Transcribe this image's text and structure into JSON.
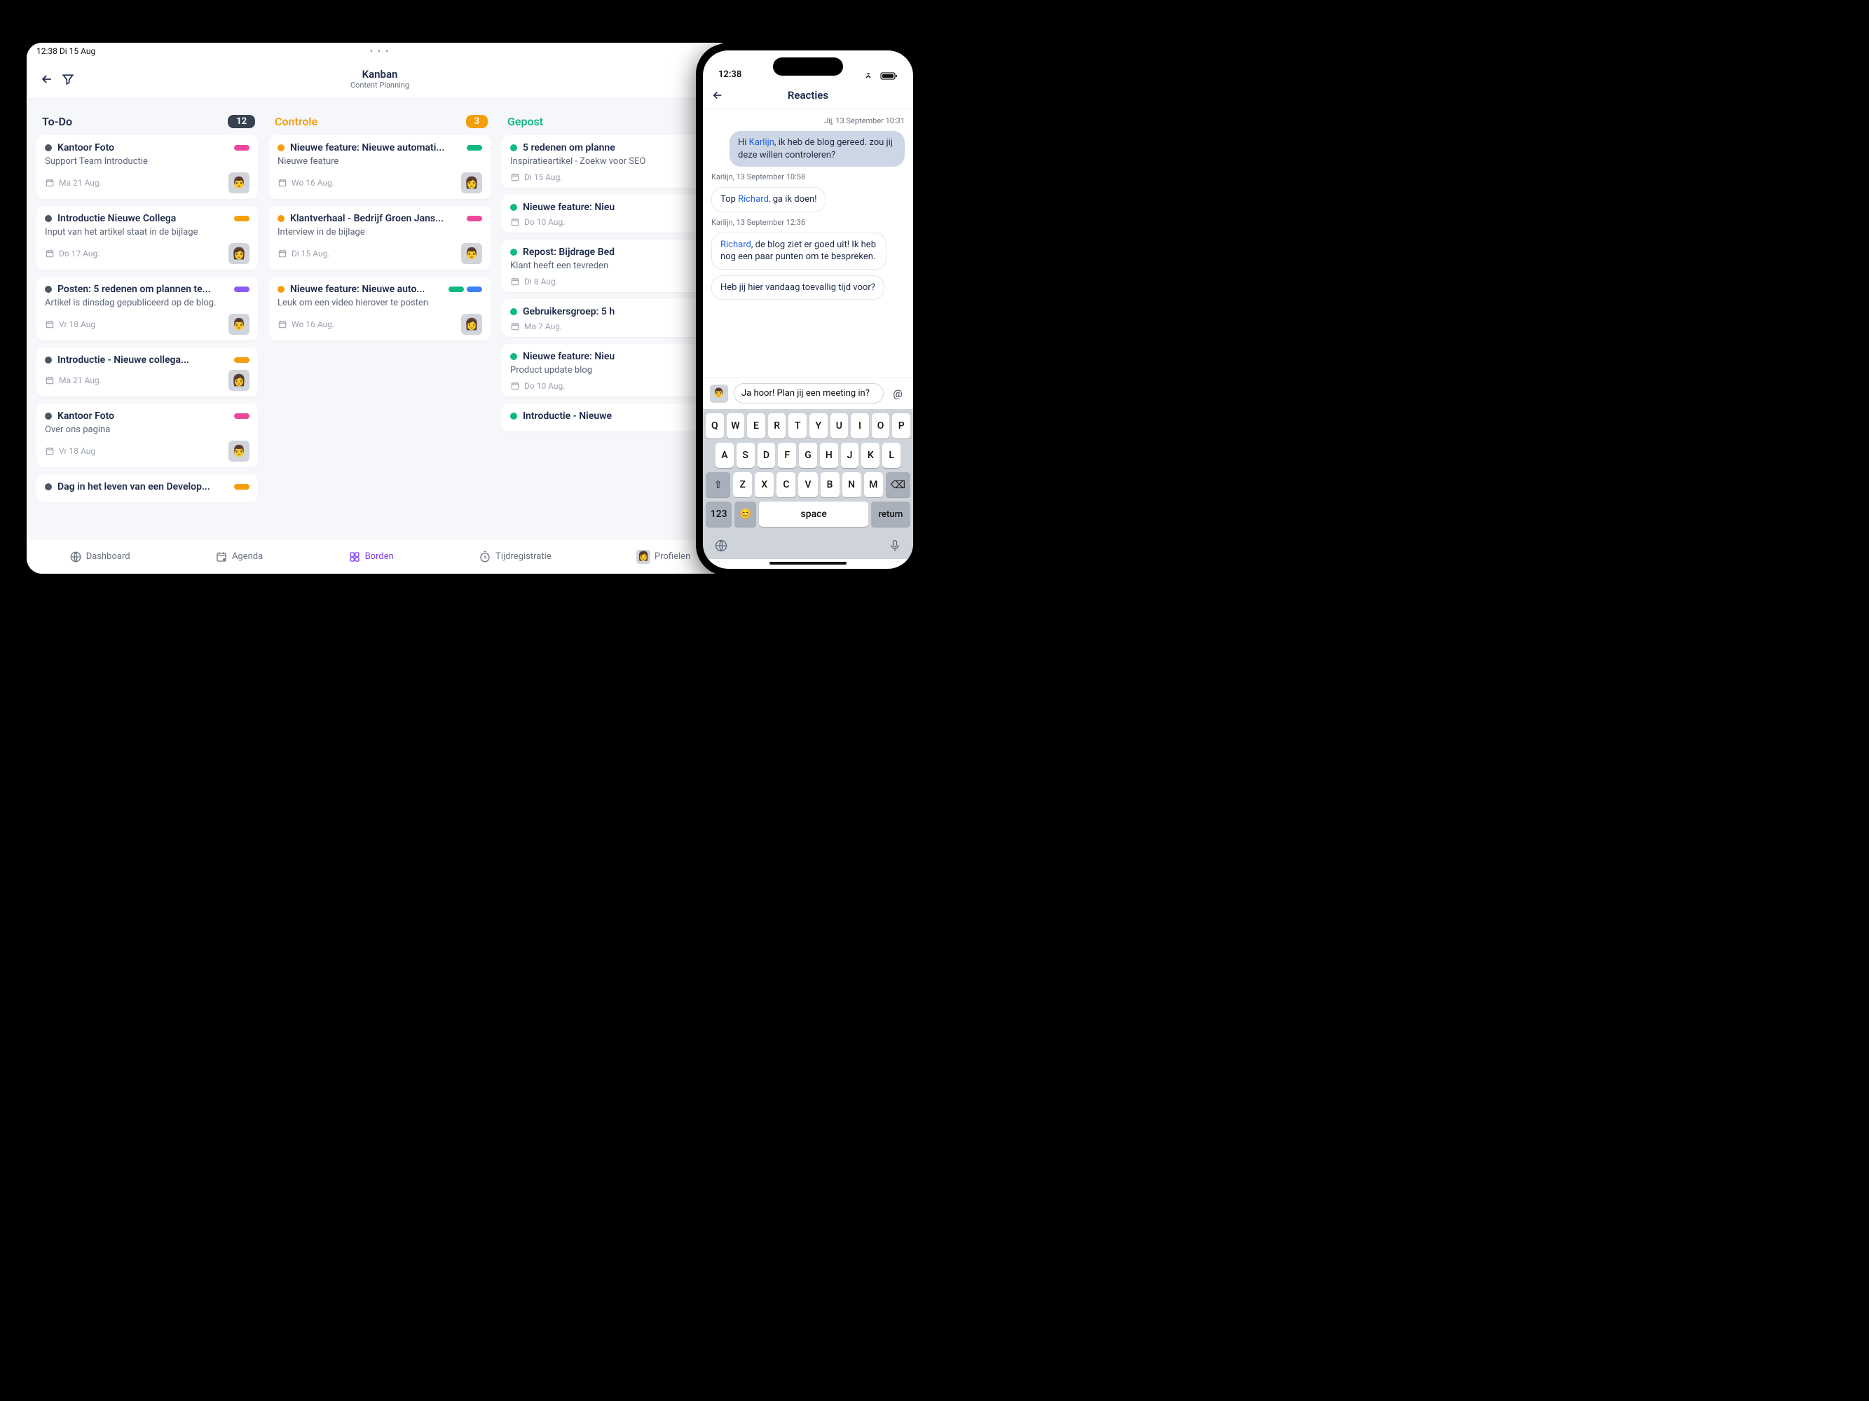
{
  "tablet": {
    "status": {
      "time_date": "12:38   Di 15 Aug",
      "dots": "• • •"
    },
    "header": {
      "title": "Kanban",
      "subtitle": "Content Planning"
    },
    "columns": [
      {
        "key": "todo",
        "title": "To-Do",
        "title_class": "todo",
        "badge": "12",
        "badge_class": "dark",
        "cards": [
          {
            "dot": "#4b5563",
            "title": "Kantoor Foto",
            "pills": [
              "#ec4899"
            ],
            "sub": "Support Team Introductie",
            "date": "Ma 21 Aug.",
            "avatar": "👨"
          },
          {
            "dot": "#4b5563",
            "title": "Introductie Nieuwe Collega",
            "pills": [
              "#f59e0b"
            ],
            "sub": "Input van het artikel staat in de bijlage",
            "date": "Do 17 Aug.",
            "avatar": "👩"
          },
          {
            "dot": "#4b5563",
            "title": "Posten: 5 redenen om plannen te...",
            "pills": [
              "#8b5cf6"
            ],
            "sub": "Artikel is dinsdag gepubliceerd op de blog.",
            "date": "Vr 18 Aug",
            "avatar": "👨"
          },
          {
            "dot": "#4b5563",
            "title": "Introductie - Nieuwe collega...",
            "pills": [
              "#f59e0b"
            ],
            "sub": "",
            "date": "Ma 21 Aug.",
            "avatar": "👩"
          },
          {
            "dot": "#4b5563",
            "title": "Kantoor Foto",
            "pills": [
              "#ec4899"
            ],
            "sub": "Over ons pagina",
            "date": "Vr 18 Aug",
            "avatar": "👨"
          },
          {
            "dot": "#4b5563",
            "title": "Dag in het leven van een Develop...",
            "pills": [
              "#f59e0b"
            ],
            "sub": "",
            "date": "",
            "avatar": ""
          }
        ]
      },
      {
        "key": "controle",
        "title": "Controle",
        "title_class": "controle",
        "badge": "3",
        "badge_class": "orange",
        "cards": [
          {
            "dot": "#f59e0b",
            "title": "Nieuwe feature: Nieuwe automati...",
            "pills": [
              "#10b981"
            ],
            "sub": "Nieuwe feature",
            "date": "Wo 16 Aug.",
            "avatar": "👩"
          },
          {
            "dot": "#f59e0b",
            "title": "Klantverhaal - Bedrijf Groen Jans...",
            "pills": [
              "#ec4899"
            ],
            "sub": "Interview in de bijlage",
            "date": "Di 15 Aug.",
            "avatar": "👨"
          },
          {
            "dot": "#f59e0b",
            "title": "Nieuwe feature: Nieuwe auto...",
            "pills": [
              "#10b981",
              "#3b82f6"
            ],
            "sub": "Leuk om een video hierover te posten",
            "date": "Wo 16 Aug.",
            "avatar": "👩"
          }
        ]
      },
      {
        "key": "gepost",
        "title": "Gepost",
        "title_class": "gepost",
        "badge": "",
        "badge_class": "",
        "cards": [
          {
            "dot": "#10b981",
            "title": "5 redenen om planne",
            "pills": [],
            "sub": "Inspiratieartikel - Zoekw voor SEO",
            "date": "Di 15 Aug.",
            "avatar": ""
          },
          {
            "dot": "#10b981",
            "title": "Nieuwe feature: Nieu",
            "pills": [],
            "sub": "",
            "date": "Do 10 Aug.",
            "avatar": ""
          },
          {
            "dot": "#10b981",
            "title": "Repost: Bijdrage Bed",
            "pills": [],
            "sub": "Klant heeft een tevreden",
            "date": "Di 8 Aug.",
            "avatar": ""
          },
          {
            "dot": "#10b981",
            "title": "Gebruikersgroep: 5 h",
            "pills": [],
            "sub": "",
            "date": "Ma 7 Aug.",
            "avatar": ""
          },
          {
            "dot": "#10b981",
            "title": "Nieuwe feature: Nieu",
            "pills": [],
            "sub": "Product update blog",
            "date": "Do 10 Aug.",
            "avatar": ""
          },
          {
            "dot": "#10b981",
            "title": "Introductie - Nieuwe",
            "pills": [],
            "sub": "",
            "date": "",
            "avatar": ""
          }
        ]
      }
    ],
    "nav": [
      {
        "icon": "globe",
        "label": "Dashboard",
        "active": false
      },
      {
        "icon": "calendar",
        "label": "Agenda",
        "active": false
      },
      {
        "icon": "grid",
        "label": "Borden",
        "active": true
      },
      {
        "icon": "timer",
        "label": "Tijdregistratie",
        "active": false
      },
      {
        "icon": "avatar",
        "label": "Profielen",
        "active": false
      }
    ]
  },
  "phone": {
    "status_time": "12:38",
    "header_title": "Reacties",
    "messages": [
      {
        "type": "ts-right",
        "text": "Jij, 13 September 10:31"
      },
      {
        "type": "out",
        "parts": [
          {
            "t": "Hi "
          },
          {
            "t": "Karlijn",
            "m": true
          },
          {
            "t": ", ik heb de blog gereed. zou jij deze willen controleren?"
          }
        ]
      },
      {
        "type": "ts-left",
        "text": "Karlijn, 13 September 10:58"
      },
      {
        "type": "in",
        "parts": [
          {
            "t": "Top "
          },
          {
            "t": "Richard,",
            "m": true
          },
          {
            "t": " ga ik doen!"
          }
        ]
      },
      {
        "type": "ts-left",
        "text": "Karlijn, 13 September 12:36"
      },
      {
        "type": "in",
        "parts": [
          {
            "t": "Richard",
            "m": true
          },
          {
            "t": ", de blog ziet er goed uit! Ik heb nog een paar punten om te bespreken."
          }
        ]
      },
      {
        "type": "in",
        "parts": [
          {
            "t": "Heb jij hier vandaag toevallig tijd voor?"
          }
        ]
      }
    ],
    "composer_value": "Ja hoor! Plan jij een meeting in?",
    "keyboard": {
      "row1": [
        "Q",
        "W",
        "E",
        "R",
        "T",
        "Y",
        "U",
        "I",
        "O",
        "P"
      ],
      "row2": [
        "A",
        "S",
        "D",
        "F",
        "G",
        "H",
        "J",
        "K",
        "L"
      ],
      "row3": [
        "Z",
        "X",
        "C",
        "V",
        "B",
        "N",
        "M"
      ],
      "num_key": "123",
      "space": "space",
      "return": "return"
    }
  }
}
